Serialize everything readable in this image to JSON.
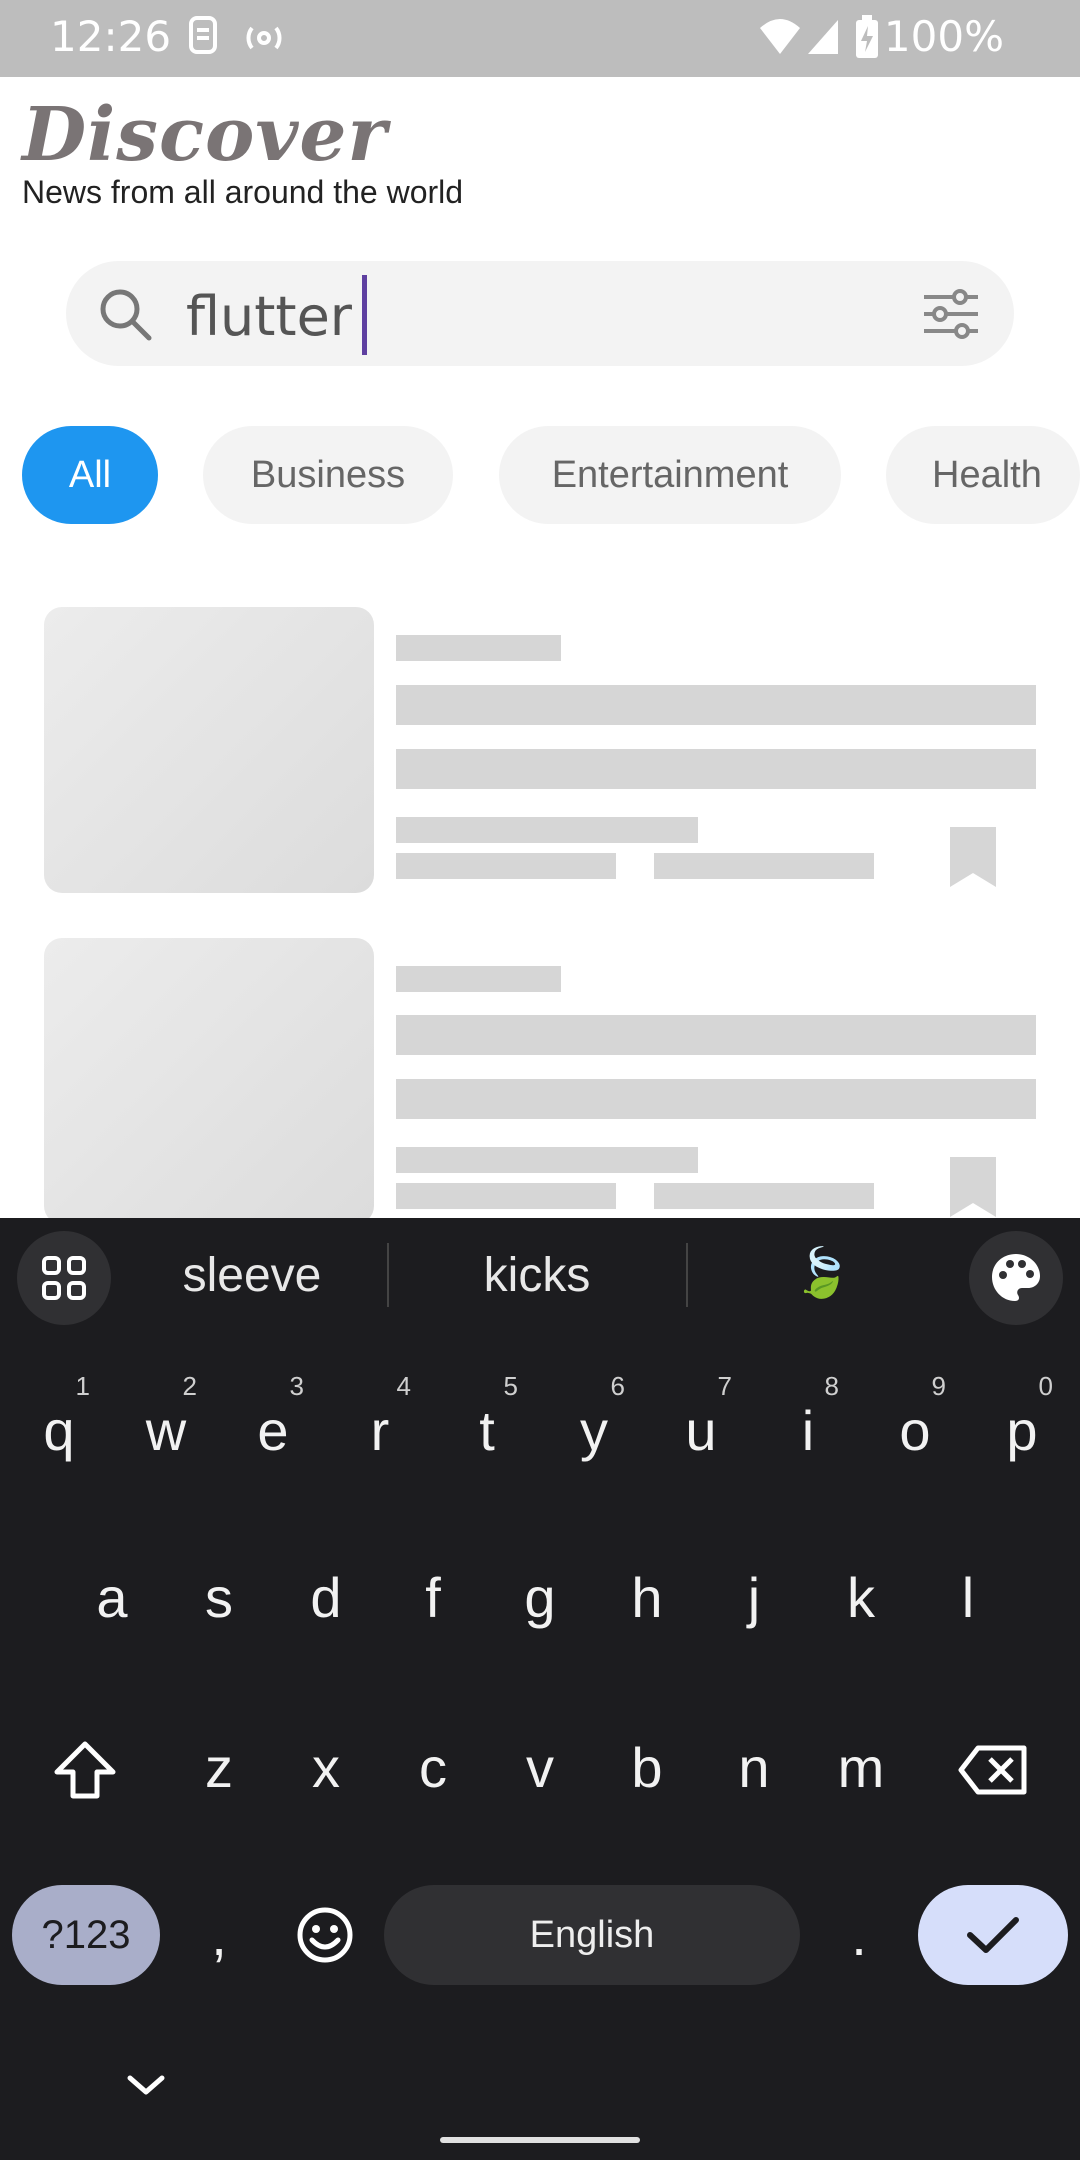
{
  "status_bar": {
    "time": "12:26",
    "battery": "100%",
    "icons": [
      "sim-card-icon",
      "hotspot-icon",
      "wifi-icon",
      "signal-icon",
      "battery-charging-icon"
    ]
  },
  "header": {
    "title": "Discover",
    "subtitle": "News from all around the world"
  },
  "search": {
    "value": "flutter",
    "left_icon": "search-icon",
    "right_icon": "filter-sliders-icon"
  },
  "categories": [
    {
      "label": "All",
      "active": true
    },
    {
      "label": "Business",
      "active": false
    },
    {
      "label": "Entertainment",
      "active": false
    },
    {
      "label": "Health",
      "active": false
    }
  ],
  "colors": {
    "accent": "#1e96f0",
    "caret": "#5e3fa0",
    "skeleton": "#d6d6d6",
    "keyboard_bg": "#1c1c1f"
  },
  "keyboard": {
    "suggestions": [
      "sleeve",
      "kicks"
    ],
    "suggestion_emoji": "🍃",
    "row1": [
      {
        "k": "q",
        "n": "1"
      },
      {
        "k": "w",
        "n": "2"
      },
      {
        "k": "e",
        "n": "3"
      },
      {
        "k": "r",
        "n": "4"
      },
      {
        "k": "t",
        "n": "5"
      },
      {
        "k": "y",
        "n": "6"
      },
      {
        "k": "u",
        "n": "7"
      },
      {
        "k": "i",
        "n": "8"
      },
      {
        "k": "o",
        "n": "9"
      },
      {
        "k": "p",
        "n": "0"
      }
    ],
    "row2": [
      "a",
      "s",
      "d",
      "f",
      "g",
      "h",
      "j",
      "k",
      "l"
    ],
    "row3": [
      "z",
      "x",
      "c",
      "v",
      "b",
      "n",
      "m"
    ],
    "symbols_label": "?123",
    "comma": ",",
    "space_label": "English",
    "period": "."
  }
}
